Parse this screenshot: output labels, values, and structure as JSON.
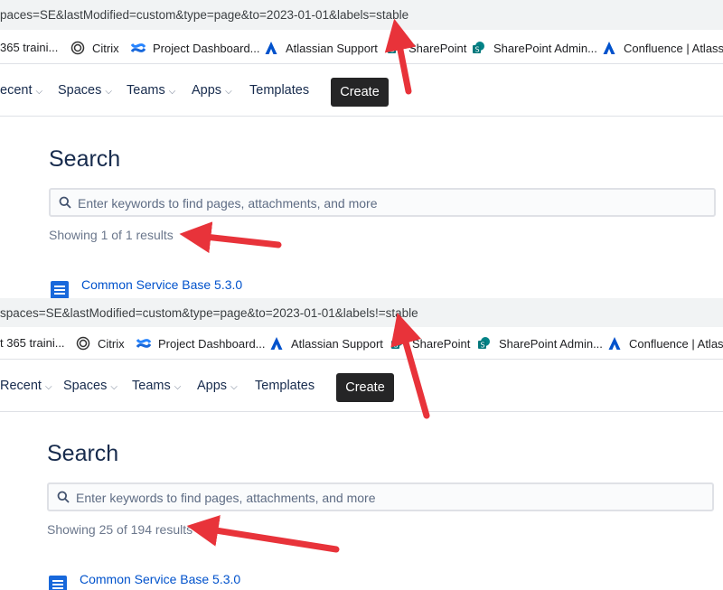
{
  "screenshots": [
    {
      "url": "paces=SE&lastModified=custom&type=page&to=2023-01-01&labels=stable",
      "bookmarks": [
        "365 traini...",
        "Citrix",
        "Project Dashboard...",
        "Atlassian Support",
        "SharePoint",
        "SharePoint Admin...",
        "Confluence | Atlassi..."
      ],
      "nav": {
        "recent": "ecent",
        "spaces": "Spaces",
        "teams": "Teams",
        "apps": "Apps",
        "templates": "Templates",
        "create": "Create"
      },
      "search_title": "Search",
      "search_placeholder": "Enter keywords to find pages, attachments, and more",
      "results_count": "Showing 1 of 1 results",
      "first_result": "Common Service Base 5.3.0"
    },
    {
      "url": "spaces=SE&lastModified=custom&type=page&to=2023-01-01&labels!=stable",
      "bookmarks": [
        "t 365 traini...",
        "Citrix",
        "Project Dashboard...",
        "Atlassian Support",
        "SharePoint",
        "SharePoint Admin...",
        "Confluence | Atlassi"
      ],
      "nav": {
        "recent": "Recent",
        "spaces": "Spaces",
        "teams": "Teams",
        "apps": "Apps",
        "templates": "Templates",
        "create": "Create"
      },
      "search_title": "Search",
      "search_placeholder": "Enter keywords to find pages, attachments, and more",
      "results_count": "Showing 25 of 194 results",
      "first_result": "Common Service Base 5.3.0"
    }
  ],
  "colors": {
    "annotation_arrow": "#e8333a",
    "link": "#0052cc",
    "create_button": "#252526"
  },
  "icons": [
    "microsoft-icon",
    "citrix-icon",
    "confluence-icon",
    "atlassian-icon",
    "sharepoint-icon",
    "search-icon",
    "page-icon",
    "chevron-down-icon"
  ]
}
